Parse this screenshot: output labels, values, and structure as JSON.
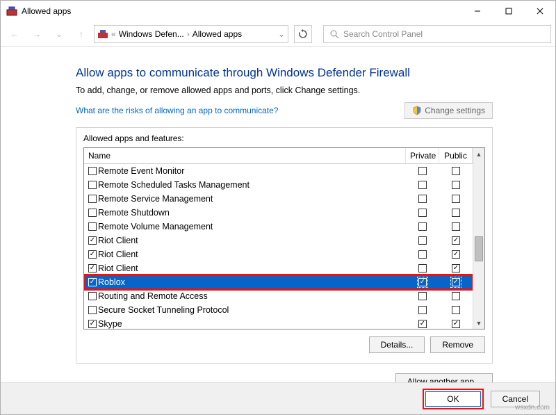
{
  "window": {
    "title": "Allowed apps"
  },
  "nav": {
    "crumb1": "Windows Defen...",
    "crumb2": "Allowed apps",
    "search_placeholder": "Search Control Panel"
  },
  "main": {
    "heading": "Allow apps to communicate through Windows Defender Firewall",
    "sub": "To add, change, or remove allowed apps and ports, click Change settings.",
    "risks_link": "What are the risks of allowing an app to communicate?",
    "change_settings": "Change settings",
    "panel_label": "Allowed apps and features:",
    "col_name": "Name",
    "col_private": "Private",
    "col_public": "Public",
    "details": "Details...",
    "remove": "Remove",
    "allow_another": "Allow another app..."
  },
  "apps": [
    {
      "name": "Remote Event Monitor",
      "enabled": false,
      "private": false,
      "public": false
    },
    {
      "name": "Remote Scheduled Tasks Management",
      "enabled": false,
      "private": false,
      "public": false
    },
    {
      "name": "Remote Service Management",
      "enabled": false,
      "private": false,
      "public": false
    },
    {
      "name": "Remote Shutdown",
      "enabled": false,
      "private": false,
      "public": false
    },
    {
      "name": "Remote Volume Management",
      "enabled": false,
      "private": false,
      "public": false
    },
    {
      "name": "Riot Client",
      "enabled": true,
      "private": false,
      "public": true
    },
    {
      "name": "Riot Client",
      "enabled": true,
      "private": false,
      "public": true
    },
    {
      "name": "Riot Client",
      "enabled": true,
      "private": false,
      "public": true
    },
    {
      "name": "Roblox",
      "enabled": true,
      "private": true,
      "public": true,
      "selected": true,
      "highlight": true
    },
    {
      "name": "Routing and Remote Access",
      "enabled": false,
      "private": false,
      "public": false
    },
    {
      "name": "Secure Socket Tunneling Protocol",
      "enabled": false,
      "private": false,
      "public": false
    },
    {
      "name": "Skype",
      "enabled": true,
      "private": true,
      "public": true
    }
  ],
  "footer": {
    "ok": "OK",
    "cancel": "Cancel"
  },
  "watermark": "wsxdn.com"
}
